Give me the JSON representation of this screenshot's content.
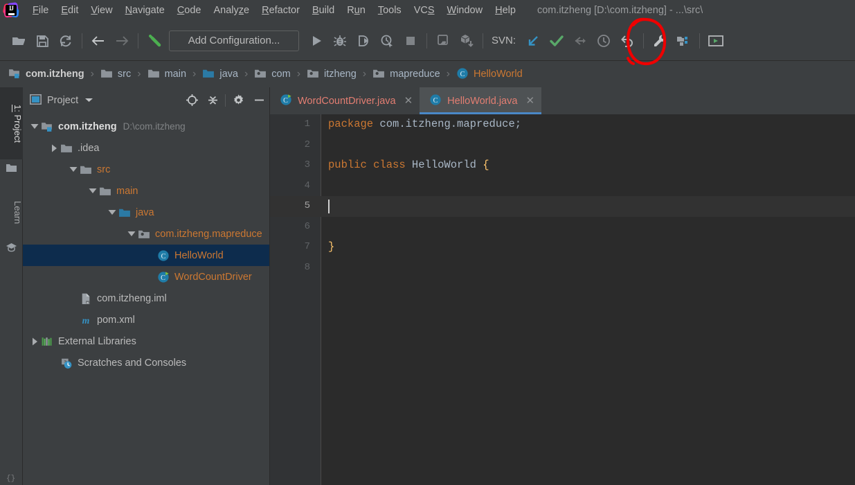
{
  "window": {
    "title": "com.itzheng [D:\\com.itzheng] - ...\\src\\",
    "logo_name": "intellij-idea-logo"
  },
  "menubar": {
    "items": [
      {
        "label": "File",
        "mnemonic": "F"
      },
      {
        "label": "Edit",
        "mnemonic": "E"
      },
      {
        "label": "View",
        "mnemonic": "V"
      },
      {
        "label": "Navigate",
        "mnemonic": "N"
      },
      {
        "label": "Code",
        "mnemonic": "C"
      },
      {
        "label": "Analyze",
        "mnemonic": "z"
      },
      {
        "label": "Refactor",
        "mnemonic": "R"
      },
      {
        "label": "Build",
        "mnemonic": "B"
      },
      {
        "label": "Run",
        "mnemonic": "u"
      },
      {
        "label": "Tools",
        "mnemonic": "T"
      },
      {
        "label": "VCS",
        "mnemonic": "S"
      },
      {
        "label": "Window",
        "mnemonic": "W"
      },
      {
        "label": "Help",
        "mnemonic": "H"
      }
    ]
  },
  "toolbar": {
    "open_label": "open-project",
    "save_label": "save-all",
    "sync_label": "synchronize",
    "back_label": "navigate-back",
    "forward_label": "navigate-forward",
    "build_label": "build-project",
    "add_configuration": "Add Configuration...",
    "run_label": "run",
    "debug_label": "debug",
    "coverage_label": "run-with-coverage",
    "profile_label": "profile",
    "stop_label": "stop",
    "svn_label": "SVN:",
    "svn_update_label": "svn-update",
    "svn_commit_label": "svn-commit",
    "svn_push_label": "svn-push",
    "history_label": "show-history",
    "rollback_label": "rollback",
    "settings_label": "settings",
    "structure_label": "project-structure",
    "present_label": "presentation-mode"
  },
  "breadcrumb": [
    {
      "label": "com.itzheng",
      "icon": "project-module-icon",
      "style": "bold"
    },
    {
      "label": "src",
      "icon": "folder-icon",
      "style": "normal"
    },
    {
      "label": "main",
      "icon": "folder-icon",
      "style": "normal"
    },
    {
      "label": "java",
      "icon": "source-folder-icon",
      "style": "normal"
    },
    {
      "label": "com",
      "icon": "package-icon",
      "style": "normal"
    },
    {
      "label": "itzheng",
      "icon": "package-icon",
      "style": "normal"
    },
    {
      "label": "mapreduce",
      "icon": "package-icon",
      "style": "normal"
    },
    {
      "label": "HelloWorld",
      "icon": "java-class-icon",
      "style": "class"
    }
  ],
  "breadcrumb_separator": "›",
  "toolstrip": {
    "project_tab": {
      "number": "1:",
      "label": "Project",
      "icon": "folder-icon"
    },
    "learn_tab": {
      "label": "Learn",
      "icon": "graduation-cap-icon"
    },
    "brace_label": "{}"
  },
  "project_panel": {
    "title": "Project",
    "dropdown_icon": "chevron-down-icon",
    "window_icon": "project-window-icon",
    "locate_icon": "select-opened-file-icon",
    "collapse_icon": "collapse-all-icon",
    "settings_icon": "gear-icon",
    "hide_icon": "minimize-icon",
    "tree": [
      {
        "label": "com.itzheng",
        "sub": "D:\\com.itzheng",
        "icon": "project-module-icon",
        "indent": 0,
        "twisty": "expanded",
        "style": "bold-plain",
        "selected": false
      },
      {
        "label": ".idea",
        "sub": "",
        "icon": "folder-icon",
        "indent": 1,
        "twisty": "collapsed",
        "style": "plain",
        "selected": false
      },
      {
        "label": "src",
        "sub": "",
        "icon": "folder-icon",
        "indent": 2,
        "twisty": "expanded",
        "style": "orange",
        "selected": false
      },
      {
        "label": "main",
        "sub": "",
        "icon": "folder-icon",
        "indent": 3,
        "twisty": "expanded",
        "style": "orange",
        "selected": false
      },
      {
        "label": "java",
        "sub": "",
        "icon": "source-folder-icon",
        "indent": 4,
        "twisty": "expanded",
        "style": "orange",
        "selected": false
      },
      {
        "label": "com.itzheng.mapreduce",
        "sub": "",
        "icon": "package-icon",
        "indent": 5,
        "twisty": "expanded",
        "style": "orange",
        "selected": false
      },
      {
        "label": "HelloWorld",
        "sub": "",
        "icon": "java-class-icon",
        "indent": 6,
        "twisty": "none",
        "style": "orange",
        "selected": true
      },
      {
        "label": "WordCountDriver",
        "sub": "",
        "icon": "java-runnable-class-icon",
        "indent": 6,
        "twisty": "none",
        "style": "orange",
        "selected": false
      },
      {
        "label": "com.itzheng.iml",
        "sub": "",
        "icon": "module-file-icon",
        "indent": 2,
        "twisty": "none",
        "style": "plain",
        "selected": false
      },
      {
        "label": "pom.xml",
        "sub": "",
        "icon": "maven-icon",
        "indent": 2,
        "twisty": "none",
        "style": "plain",
        "selected": false
      },
      {
        "label": "External Libraries",
        "sub": "",
        "icon": "libraries-icon",
        "indent": 0,
        "twisty": "collapsed",
        "style": "plain",
        "selected": false
      },
      {
        "label": "Scratches and Consoles",
        "sub": "",
        "icon": "scratches-icon",
        "indent": 1,
        "twisty": "none",
        "style": "plain",
        "selected": false
      }
    ]
  },
  "editor": {
    "tabs": [
      {
        "label": "WordCountDriver.java",
        "icon": "java-runnable-class-icon",
        "active": false,
        "close": "✕"
      },
      {
        "label": "HelloWorld.java",
        "icon": "java-class-icon",
        "active": true,
        "close": "✕"
      }
    ],
    "lines": [
      {
        "number": "1",
        "tokens": [
          {
            "t": "package",
            "c": "kw"
          },
          {
            "t": " com.itzheng.mapreduce;",
            "c": "pk"
          }
        ],
        "caret": false
      },
      {
        "number": "2",
        "tokens": [],
        "caret": false
      },
      {
        "number": "3",
        "tokens": [
          {
            "t": "public class",
            "c": "kw"
          },
          {
            "t": " HelloWorld ",
            "c": "cl"
          },
          {
            "t": "{",
            "c": "br"
          }
        ],
        "caret": false
      },
      {
        "number": "4",
        "tokens": [],
        "caret": false
      },
      {
        "number": "5",
        "tokens": [],
        "caret": true
      },
      {
        "number": "6",
        "tokens": [],
        "caret": false
      },
      {
        "number": "7",
        "tokens": [
          {
            "t": "}",
            "c": "br"
          }
        ],
        "caret": false
      },
      {
        "number": "8",
        "tokens": [],
        "caret": false
      }
    ]
  },
  "annotation": {
    "shape": "red-ellipse-highlight",
    "target": "svn-commit-button",
    "color": "#ee0000"
  },
  "colors": {
    "chrome": "#3c3f41",
    "editor_bg": "#2b2b2b",
    "gutter_bg": "#313335",
    "selection": "#0d2c4d",
    "tab_active": "#4e5254",
    "tab_underline": "#4a88c7",
    "orange_text": "#cc7832",
    "salmon_text": "#e37e72",
    "green_accent": "#59a869",
    "blue_accent": "#3592c4",
    "annotation_red": "#ee0000"
  }
}
